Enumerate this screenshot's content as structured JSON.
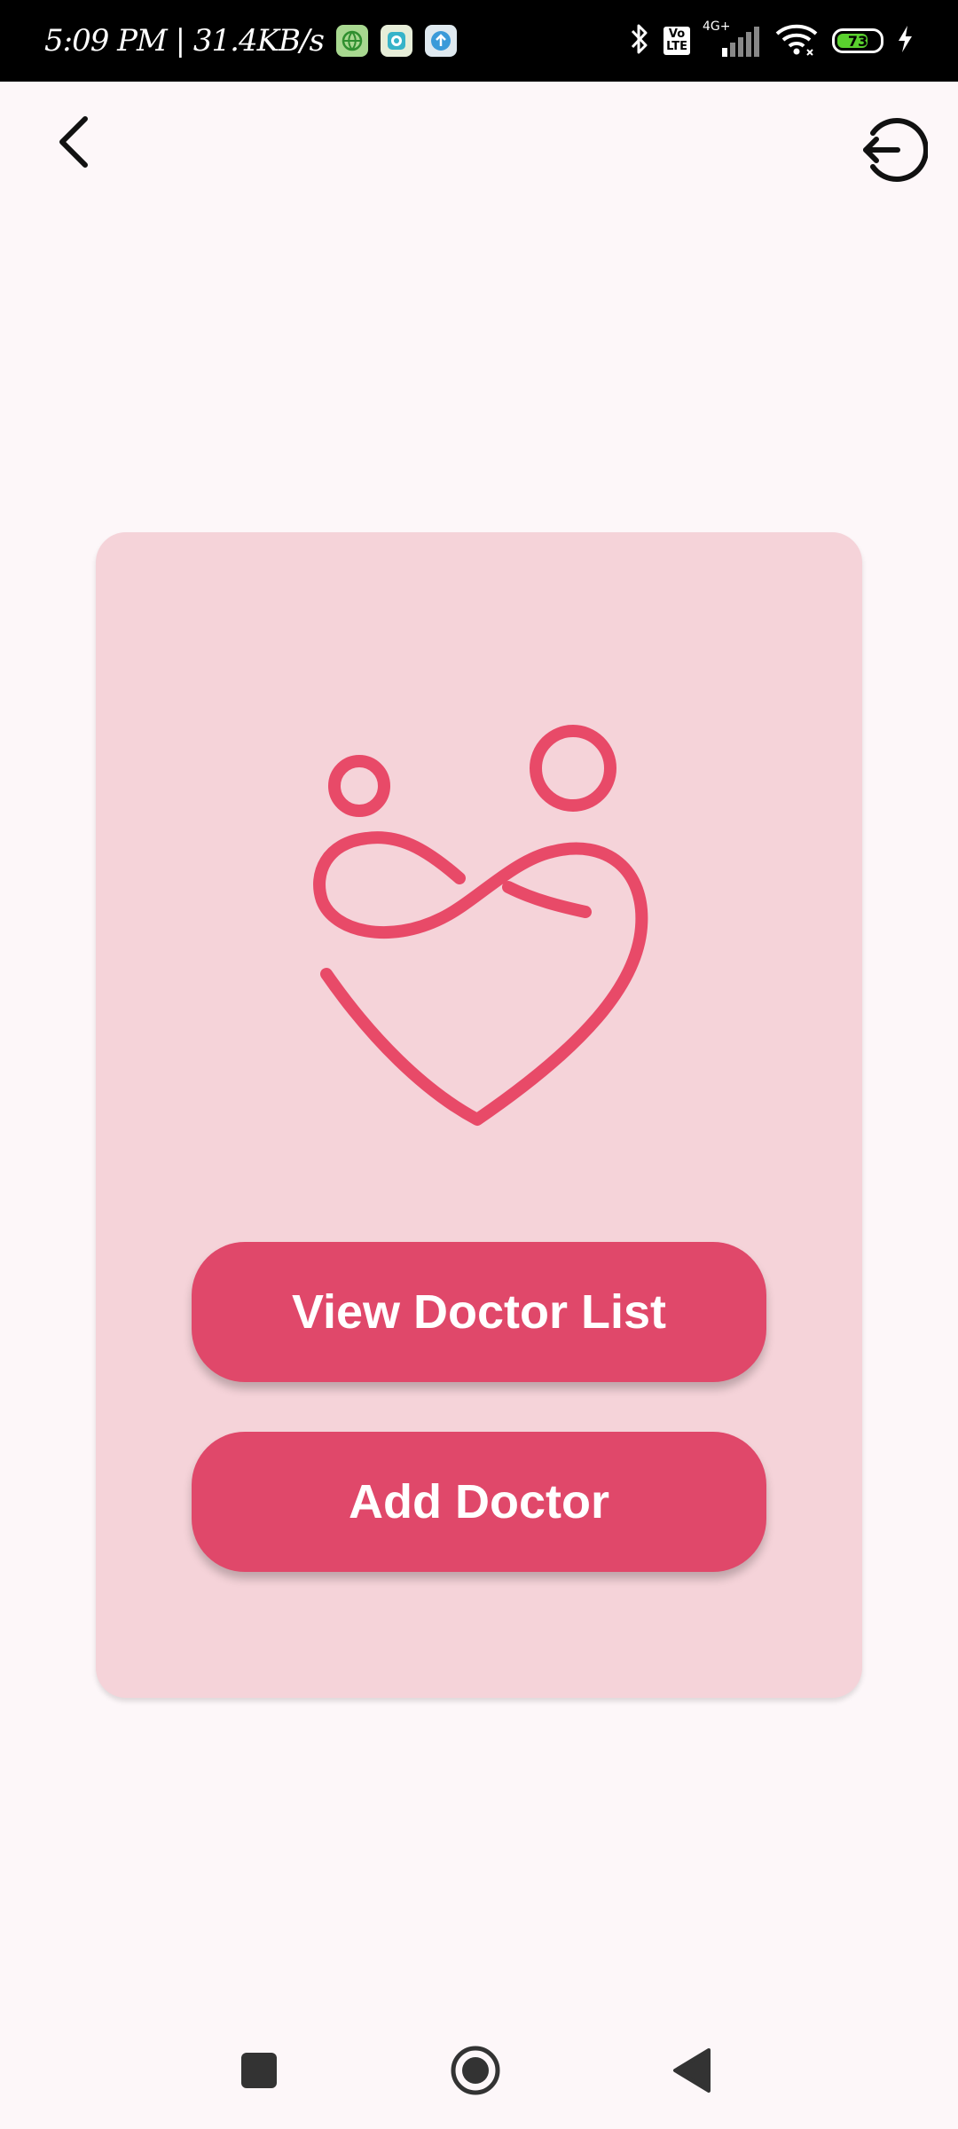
{
  "status_bar": {
    "time": "5:09 PM | 31.4KB/s",
    "network_type": "4G+",
    "volte_label": "Vo\nLTE",
    "battery_level": "73",
    "battery_fraction": 0.73
  },
  "icons": {
    "back": "back-arrow-icon",
    "logout": "logout-icon",
    "logo": "heart-infinity-logo-icon",
    "nav_recents": "square-icon",
    "nav_home": "circle-icon",
    "nav_back": "triangle-icon"
  },
  "main": {
    "view_doctor_list_label": "View Doctor List",
    "add_doctor_label": "Add Doctor"
  },
  "colors": {
    "accent": "#e0486a",
    "card_background": "#f5d3d9",
    "logo_stroke": "#e84a68",
    "page_background": "#fdf7f9"
  }
}
